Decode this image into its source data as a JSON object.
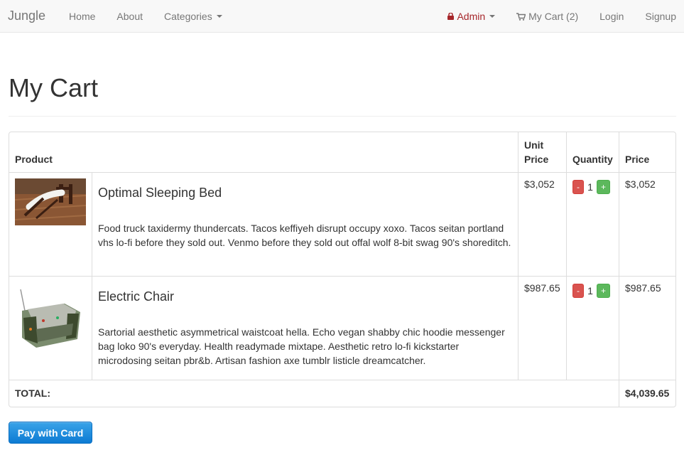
{
  "navbar": {
    "brand": "Jungle",
    "links": {
      "home": "Home",
      "about": "About",
      "categories": "Categories"
    },
    "right": {
      "admin": "Admin",
      "cart": "My Cart (2)",
      "login": "Login",
      "signup": "Signup"
    }
  },
  "page": {
    "title": "My Cart"
  },
  "table": {
    "headers": {
      "product": "Product",
      "unit_price_1": "Unit",
      "unit_price_2": "Price",
      "quantity": "Quantity",
      "price": "Price"
    },
    "items": [
      {
        "name": "Optimal Sleeping Bed",
        "description": "Food truck taxidermy thundercats. Tacos keffiyeh disrupt occupy xoxo. Tacos seitan portland vhs lo-fi before they sold out. Venmo before they sold out offal wolf 8-bit swag 90's shoreditch.",
        "unit_price": "$3,052",
        "quantity": "1",
        "minus": "-",
        "plus": "+",
        "price": "$3,052"
      },
      {
        "name": "Electric Chair",
        "description": "Sartorial aesthetic asymmetrical waistcoat hella. Echo vegan shabby chic hoodie messenger bag loko 90's everyday. Health readymade mixtape. Aesthetic retro lo-fi kickstarter microdosing seitan pbr&b. Artisan fashion axe tumblr listicle dreamcatcher.",
        "unit_price": "$987.65",
        "quantity": "1",
        "minus": "-",
        "plus": "+",
        "price": "$987.65"
      }
    ],
    "total_label": "TOTAL:",
    "total_value": "$4,039.65"
  },
  "actions": {
    "pay": "Pay with Card"
  },
  "colors": {
    "admin": "#a6262a",
    "minus": "#d9534f",
    "plus": "#5cb85c",
    "pay": "#1580d8"
  }
}
